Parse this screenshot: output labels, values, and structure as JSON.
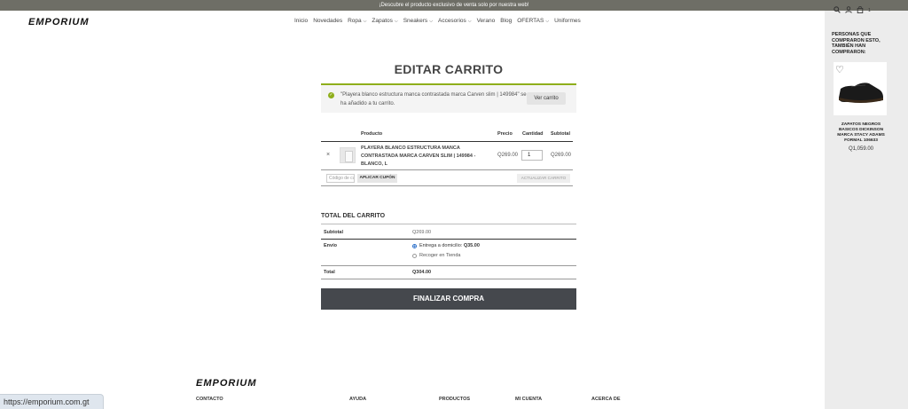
{
  "topbar": {
    "text": "¡Descubre el producto exclusivo de venta solo por nuestra web!"
  },
  "brand": {
    "logo": "EMPORIUM"
  },
  "nav": {
    "items": [
      {
        "label": "Inicio",
        "dropdown": false
      },
      {
        "label": "Novedades",
        "dropdown": false
      },
      {
        "label": "Ropa",
        "dropdown": true
      },
      {
        "label": "Zapatos",
        "dropdown": true
      },
      {
        "label": "Sneakers",
        "dropdown": true
      },
      {
        "label": "Accesorios",
        "dropdown": true
      },
      {
        "label": "Verano",
        "dropdown": false
      },
      {
        "label": "Blog",
        "dropdown": false
      },
      {
        "label": "OFERTAS",
        "dropdown": true
      },
      {
        "label": "Uniformes",
        "dropdown": false
      }
    ],
    "cart_count": "1"
  },
  "page": {
    "title": "EDITAR CARRITO"
  },
  "notice": {
    "message": "\"Playera blanco estructura manca contrastada marca Carven slim | 149984\" se ha añadido a tu carrito.",
    "button": "Ver carrito"
  },
  "cart": {
    "headers": {
      "product": "Producto",
      "price": "Precio",
      "quantity": "Cantidad",
      "subtotal": "Subtotal"
    },
    "item": {
      "name": "PLAYERA BLANCO ESTRUCTURA MANCA CONTRASTADA MARCA CARVEN SLIM | 149984 - BLANCO, L",
      "price": "Q269.00",
      "quantity": "1",
      "subtotal": "Q269.00"
    },
    "coupon_placeholder": "Código de cupón",
    "apply_coupon": "APLICAR CUPÓN",
    "update_cart": "ACTUALIZAR CARRITO"
  },
  "totals": {
    "title": "TOTAL DEL CARRITO",
    "subtotal_label": "Subtotal",
    "subtotal_value": "Q269.00",
    "shipping_label": "Envío",
    "shipping_option1": "Entrega a domicilio:",
    "shipping_option1_price": "Q35.00",
    "shipping_option2": "Recoger en Tienda",
    "total_label": "Total",
    "total_value": "Q304.00",
    "checkout": "FINALIZAR COMPRA"
  },
  "related": {
    "title": "PERSONAS QUE COMPRARON ESTO, TAMBIÉN HAN COMPRARON:",
    "product_name": "ZAPATOS NEGROS BASICOS DICKINSON MARCA STACY ADAMS FORMAL 106633",
    "product_price": "Q1,059.00"
  },
  "footer": {
    "logo": "EMPORIUM",
    "columns": [
      "CONTACTO",
      "AYUDA",
      "PRODUCTOS",
      "MI CUENTA",
      "ACERCA DE"
    ]
  },
  "statusbar": {
    "url": "https://emporium.com.gt"
  }
}
